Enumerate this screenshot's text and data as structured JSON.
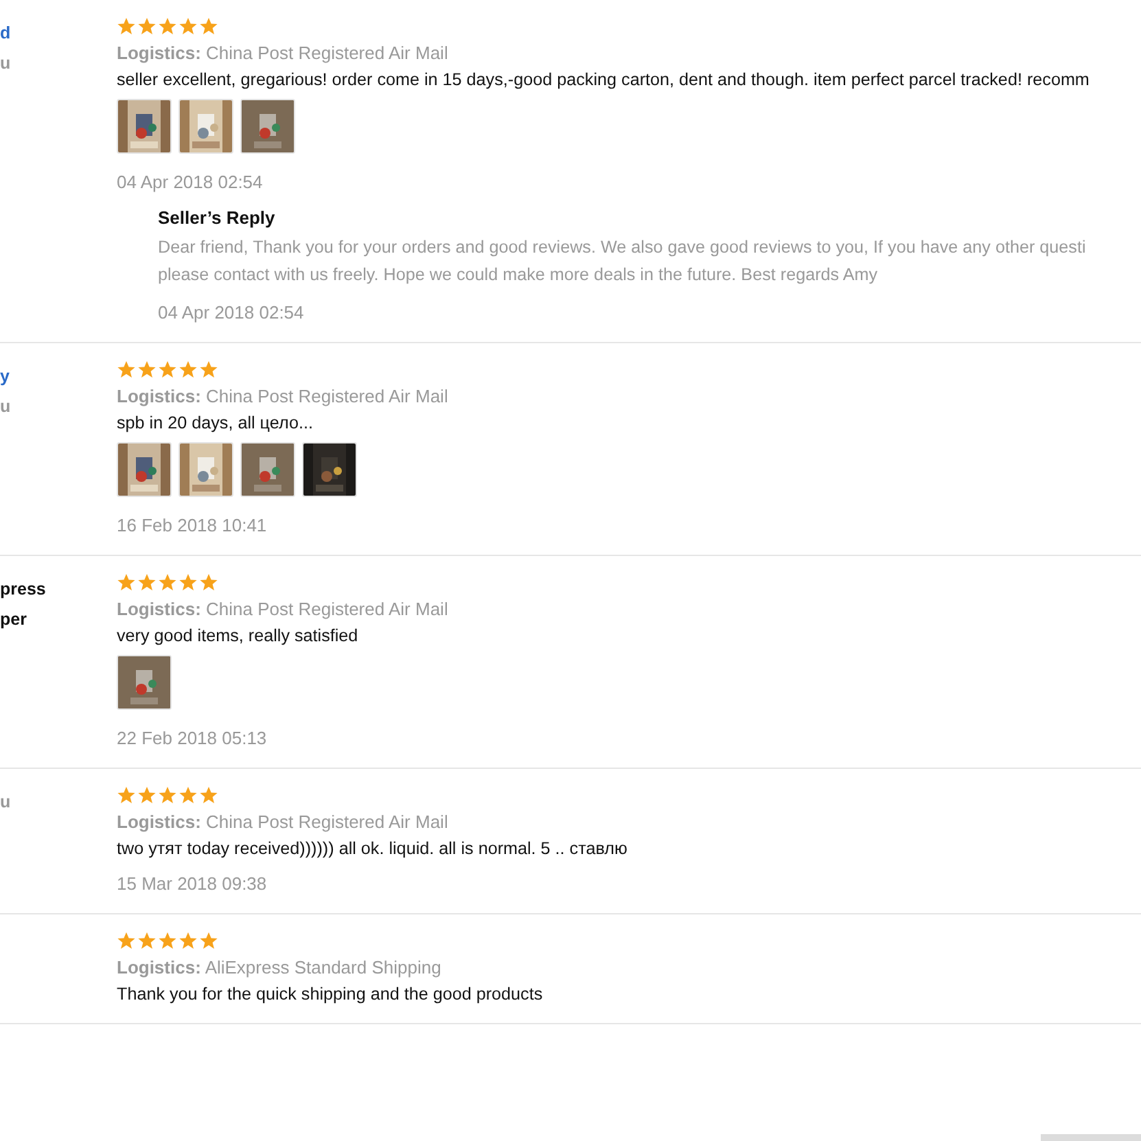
{
  "reviews": [
    {
      "buyer": [
        {
          "kind": "link",
          "text": "d"
        },
        {
          "kind": "info",
          "text": "u"
        }
      ],
      "stars": 5,
      "logistics_label": "Logistics:",
      "logistics": "China Post Registered Air Mail",
      "text": "seller excellent, gregarious! order come in 15 days,-good packing carton, dent and though. item perfect parcel tracked! recomm",
      "photos": [
        {
          "kind": "picture"
        },
        {
          "kind": "picture"
        },
        {
          "kind": "picture"
        }
      ],
      "date": "04 Apr 2018 02:54",
      "reply": {
        "title": "Seller’s Reply",
        "lines": [
          "Dear friend, Thank you for your orders and good reviews. We also gave good reviews to you, If you have any other questi",
          "please contact with us freely. Hope we could make more deals in the future. Best regards Amy"
        ],
        "date": "04 Apr 2018 02:54"
      }
    },
    {
      "buyer": [
        {
          "kind": "link",
          "text": "y"
        },
        {
          "kind": "info",
          "text": "u"
        }
      ],
      "stars": 5,
      "logistics_label": "Logistics:",
      "logistics": "China Post Registered Air Mail",
      "text": "spb in 20 days, all цело...",
      "photos": [
        {
          "kind": "picture"
        },
        {
          "kind": "picture"
        },
        {
          "kind": "picture"
        },
        {
          "kind": "picture"
        }
      ],
      "date": "16 Feb 2018 10:41"
    },
    {
      "buyer": [
        {
          "kind": "plain",
          "text": "press"
        },
        {
          "kind": "plain",
          "text": "per"
        }
      ],
      "stars": 5,
      "logistics_label": "Logistics:",
      "logistics": "China Post Registered Air Mail",
      "text": "very good items, really satisfied",
      "photos": [
        {
          "kind": "picture"
        }
      ],
      "date": "22 Feb 2018 05:13"
    },
    {
      "buyer": [
        {
          "kind": "info",
          "text": "u"
        }
      ],
      "stars": 5,
      "logistics_label": "Logistics:",
      "logistics": "China Post Registered Air Mail",
      "text": "two утят today received)))))) all ok. liquid. all is normal. 5 .. ставлю",
      "date": "15 Mar 2018 09:38"
    },
    {
      "stars": 5,
      "logistics_label": "Logistics:",
      "logistics": "AliExpress Standard Shipping",
      "text": "Thank you for the quick shipping and the good products"
    }
  ]
}
